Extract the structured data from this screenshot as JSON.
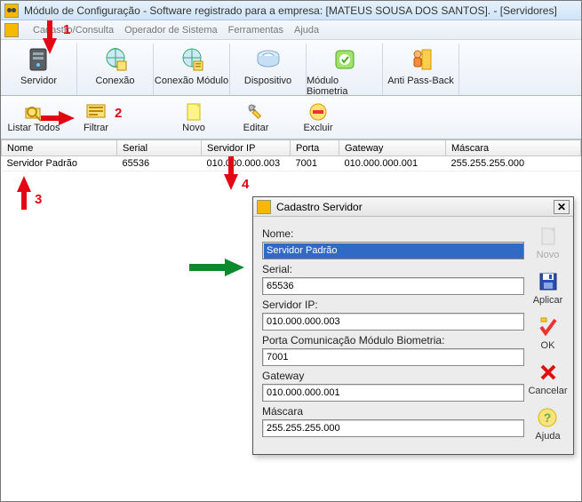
{
  "window": {
    "title": "Módulo de Configuração - Software registrado para a empresa: [MATEUS SOUSA DOS SANTOS]. - [Servidores]"
  },
  "menu": {
    "items": [
      "Cadastro/Consulta",
      "Operador de Sistema",
      "Ferramentas",
      "Ajuda"
    ]
  },
  "toolbar": {
    "servidor": "Servidor",
    "conexao": "Conexão",
    "conexao_modulo": "Conexão Módulo",
    "dispositivo": "Dispositivo",
    "modulo_biometria": "Módulo Biometria",
    "anti_passback": "Anti Pass-Back"
  },
  "subtoolbar": {
    "listar_todos": "Listar Todos",
    "filtrar": "Filtrar",
    "novo": "Novo",
    "editar": "Editar",
    "excluir": "Excluir"
  },
  "grid": {
    "headers": [
      "Nome",
      "Serial",
      "Servidor IP",
      "Porta",
      "Gateway",
      "Máscara"
    ],
    "rows": [
      {
        "nome": "Servidor Padrão",
        "serial": "65536",
        "ip": "010.000.000.003",
        "porta": "7001",
        "gateway": "010.000.000.001",
        "mascara": "255.255.255.000"
      }
    ]
  },
  "dialog": {
    "title": "Cadastro Servidor",
    "fields": {
      "nome_label": "Nome:",
      "nome_value": "Servidor Padrão",
      "serial_label": "Serial:",
      "serial_value": "65536",
      "ip_label": "Servidor IP:",
      "ip_value": "010.000.000.003",
      "porta_label": "Porta Comunicação Módulo Biometria:",
      "porta_value": "7001",
      "gateway_label": "Gateway",
      "gateway_value": "010.000.000.001",
      "mascara_label": "Máscara",
      "mascara_value": "255.255.255.000"
    },
    "buttons": {
      "novo": "Novo",
      "aplicar": "Aplicar",
      "ok": "OK",
      "cancelar": "Cancelar",
      "ajuda": "Ajuda"
    }
  },
  "annotations": {
    "n1": "1",
    "n2": "2",
    "n3": "3",
    "n4": "4"
  }
}
